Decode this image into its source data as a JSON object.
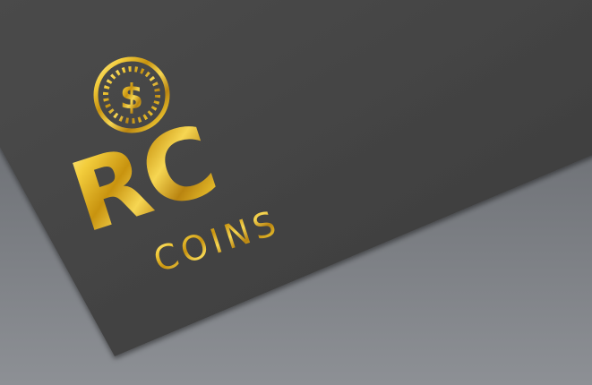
{
  "logo": {
    "symbol": "$",
    "monogram": "RC",
    "wordmark": "COINS"
  },
  "colors": {
    "background": "#7a7d82",
    "card": "#454545",
    "gold_light": "#ffe98a",
    "gold": "#e2b51c",
    "gold_dark": "#9a6e07"
  },
  "icons": [
    "coin-dollar-icon"
  ]
}
